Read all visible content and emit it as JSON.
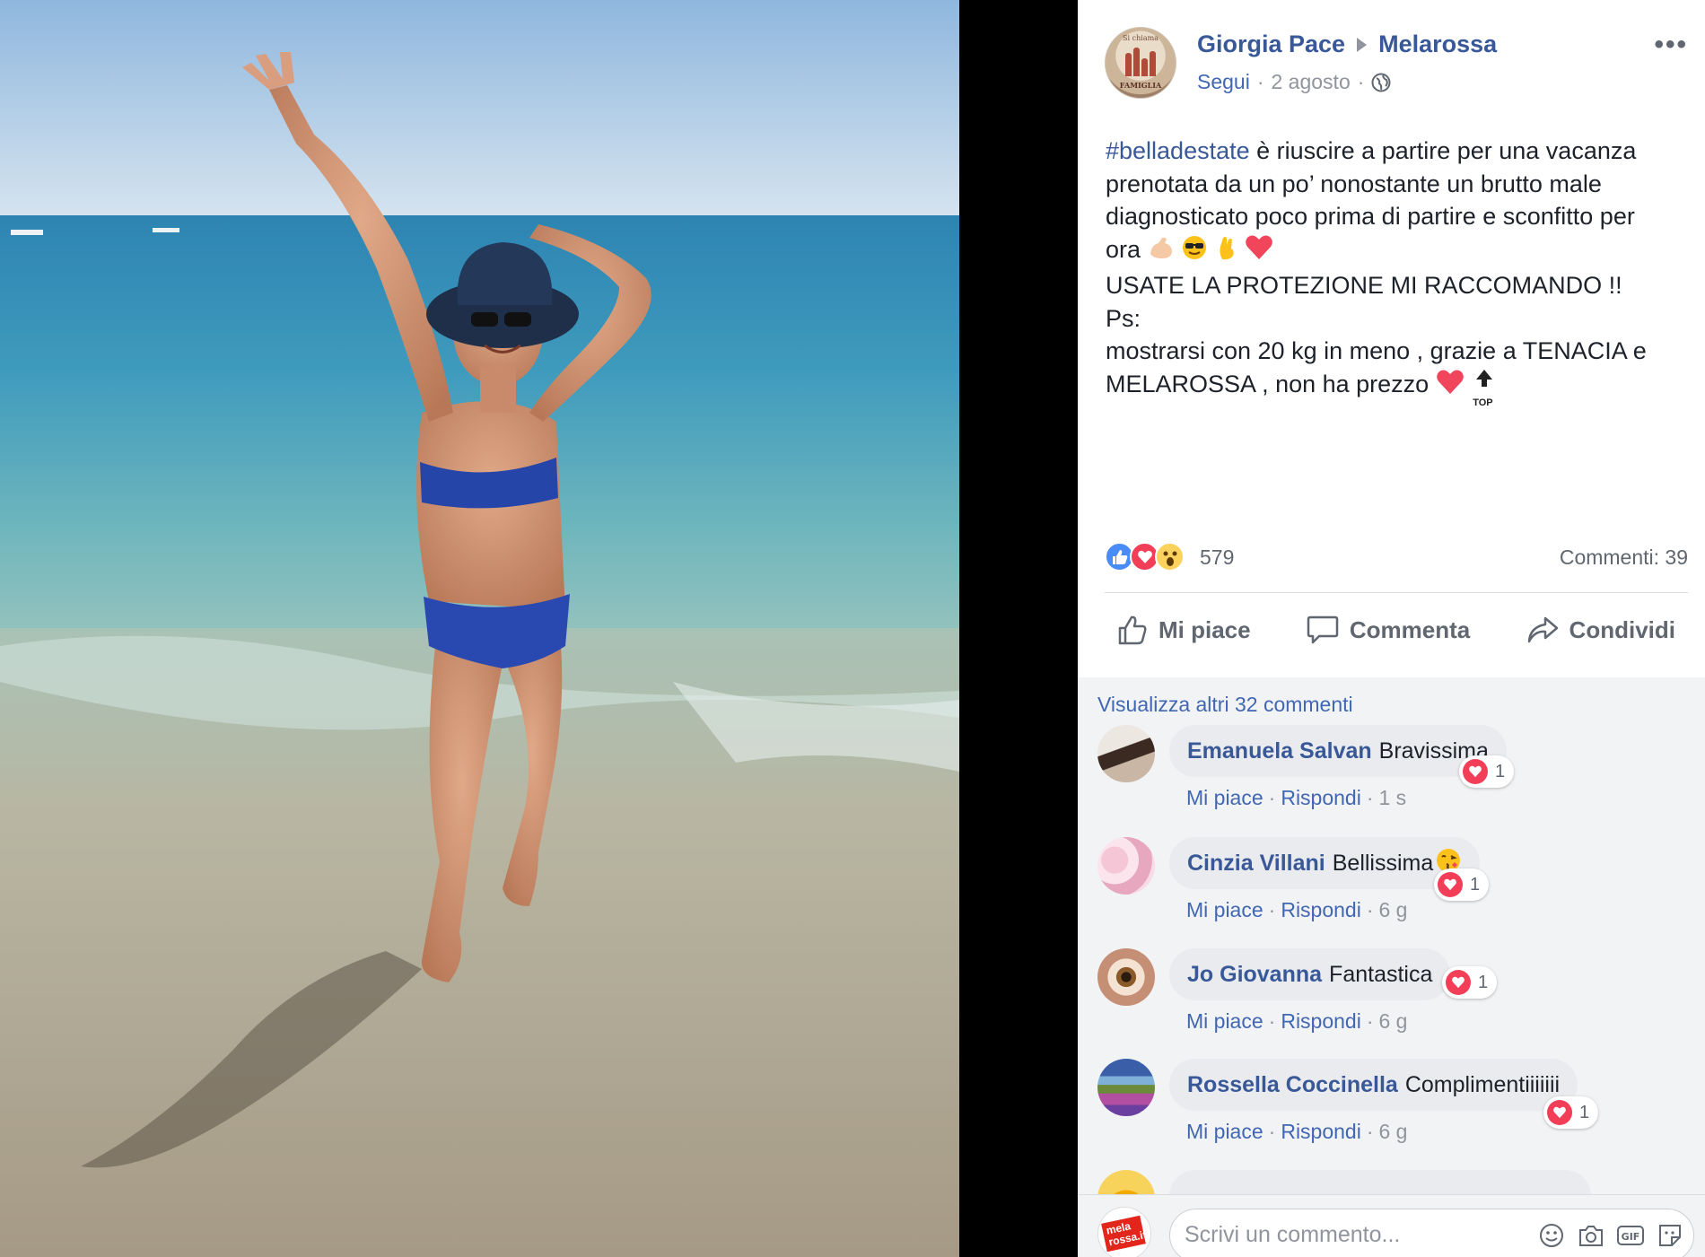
{
  "post": {
    "author": "Giorgia Pace",
    "page": "Melarossa",
    "follow_label": "Segui",
    "date": "2 agosto",
    "avatar_text_top": "Si chiama",
    "avatar_text_bottom": "FAMIGLIA",
    "hashtag": "#belladestate",
    "lines": [
      " è riuscire a partire per una vacanza",
      "prenotata da un po’ nonostante un brutto male",
      "diagnosticato poco prima di partire e sconfitto per",
      "ora",
      "USATE LA PROTEZIONE MI RACCOMANDO !!",
      "Ps:",
      "mostrarsi con 20 kg in meno , grazie a TENACIA e",
      "MELAROSSA , non ha prezzo"
    ],
    "top_label": "TOP"
  },
  "reactions": {
    "count": "579",
    "comments": "Commenti: 39"
  },
  "actions": {
    "like": "Mi piace",
    "comment": "Commenta",
    "share": "Condividi"
  },
  "comments_section": {
    "view_more": "Visualizza altri 32 commenti",
    "like_label": "Mi piace",
    "reply_label": "Rispondi",
    "items": [
      {
        "name": "Emanuela Salvan",
        "text": "Bravissima",
        "time": "1 s",
        "likes": "1"
      },
      {
        "name": "Cinzia Villani",
        "text": "Bellissima",
        "time": "6 g",
        "likes": "1"
      },
      {
        "name": "Jo Giovanna",
        "text": "Fantastica",
        "time": "6 g",
        "likes": "1"
      },
      {
        "name": "Rossella Coccinella",
        "text": "Complimentiiiiiii",
        "time": "6 g",
        "likes": "1"
      }
    ]
  },
  "compose": {
    "placeholder": "Scrivi un commento...",
    "avatar_text": "mela rossa.it"
  },
  "colors": {
    "link": "#385898",
    "accent": "#4267b2",
    "love": "#f33e58",
    "like": "#4a8cf7",
    "muted": "#90949c"
  }
}
